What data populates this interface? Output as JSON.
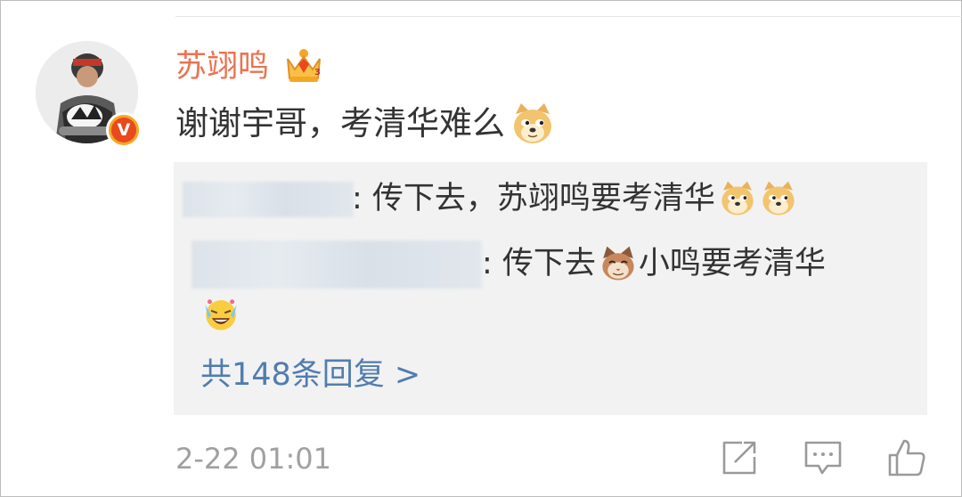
{
  "comment": {
    "username": "苏翊鸣",
    "text": "谢谢宇哥，考清华难么",
    "text_emoji": "doge-emoji",
    "crown_badge": "crown-level-icon",
    "verified_badge_label": "V",
    "timestamp": "2-22 01:01"
  },
  "replies": [
    {
      "text": ": 传下去，苏翊鸣要考清华",
      "emojis": [
        "doge-emoji",
        "doge-emoji"
      ]
    },
    {
      "text_before": ": 传下去",
      "emoji": "cat-emoji",
      "text_after": "小鸣要考清华",
      "line2_emoji": "laugh-cry-emoji"
    }
  ],
  "more_replies_label": "共148条回复 >",
  "actions": [
    "share-icon",
    "comment-icon",
    "like-icon"
  ],
  "colors": {
    "username": "#eb7350",
    "link": "#507daf",
    "reply_bg": "#f2f2f2",
    "timestamp": "#a0a0a0",
    "verified": "#e8491d"
  }
}
